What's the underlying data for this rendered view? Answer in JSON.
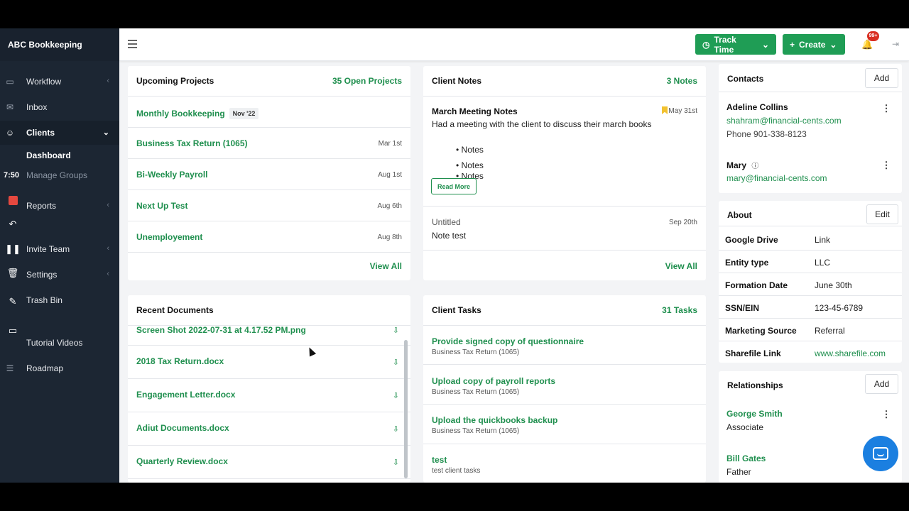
{
  "app": {
    "brand": "ABC Bookkeeping"
  },
  "sidebar": {
    "items": [
      {
        "label": "Workflow",
        "icon": "briefcase-icon"
      },
      {
        "label": "Inbox",
        "icon": "mail-icon"
      },
      {
        "label": "Clients",
        "icon": "users-icon"
      },
      {
        "label": "Reports",
        "icon": "chart-icon"
      },
      {
        "label": "Invite Team",
        "icon": "user-plus-icon"
      },
      {
        "label": "Settings",
        "icon": "gear-icon"
      },
      {
        "label": "Trash Bin",
        "icon": "trash-icon"
      },
      {
        "label": "Tutorial Videos",
        "icon": "video-icon"
      },
      {
        "label": "Roadmap",
        "icon": "roadmap-icon"
      }
    ],
    "sub_items": [
      {
        "label": "Dashboard"
      },
      {
        "label": "Manage Groups"
      }
    ],
    "recording_time": "7:50"
  },
  "topbar": {
    "track_time_label": "Track Time",
    "create_label": "Create",
    "notification_badge": "99+"
  },
  "upcoming_projects": {
    "title": "Upcoming Projects",
    "count": "35 Open Projects",
    "items": [
      {
        "name": "Monthly Bookkeeping",
        "chip": "Nov '22",
        "date": ""
      },
      {
        "name": "Business Tax Return (1065)",
        "date": "Mar 1st"
      },
      {
        "name": "Bi-Weekly Payroll",
        "date": "Aug 1st"
      },
      {
        "name": "Next Up Test",
        "date": "Aug 6th"
      },
      {
        "name": "Unemployement",
        "date": "Aug 8th"
      }
    ],
    "view_all": "View All"
  },
  "client_notes": {
    "title": "Client Notes",
    "count": "3 Notes",
    "note1": {
      "title": "March Meeting Notes",
      "date": "May 31st",
      "body": "Had a meeting with the client to discuss their march books",
      "bullets": [
        "Notes",
        "Notes",
        "Notes"
      ],
      "read_more": "Read More"
    },
    "note2": {
      "title": "Untitled",
      "date": "Sep 20th",
      "body": "Note test"
    },
    "view_all": "View All"
  },
  "recent_documents": {
    "title": "Recent Documents",
    "items": [
      {
        "name": "Screen Shot 2022-07-31 at 4.17.52 PM.png"
      },
      {
        "name": "2018 Tax Return.docx"
      },
      {
        "name": "Engagement Letter.docx"
      },
      {
        "name": "Adiut Documents.docx"
      },
      {
        "name": "Quarterly Review.docx"
      }
    ]
  },
  "client_tasks": {
    "title": "Client Tasks",
    "count": "31 Tasks",
    "items": [
      {
        "name": "Provide signed copy of questionnaire",
        "project": "Business Tax Return (1065)"
      },
      {
        "name": "Upload copy of payroll reports",
        "project": "Business Tax Return (1065)"
      },
      {
        "name": "Upload the quickbooks backup",
        "project": "Business Tax Return (1065)"
      },
      {
        "name": "test",
        "project": "test client tasks"
      }
    ]
  },
  "contacts": {
    "title": "Contacts",
    "add_label": "Add",
    "people": [
      {
        "name": "Adeline Collins",
        "email": "shahram@financial-cents.com",
        "phone": "Phone 901-338-8123"
      },
      {
        "name": "Mary",
        "email": "mary@financial-cents.com"
      }
    ]
  },
  "about": {
    "title": "About",
    "edit_label": "Edit",
    "fields": [
      {
        "key": "Google Drive",
        "value": "Link"
      },
      {
        "key": "Entity type",
        "value": "LLC"
      },
      {
        "key": "Formation Date",
        "value": "June 30th"
      },
      {
        "key": "SSN/EIN",
        "value": "123-45-6789"
      },
      {
        "key": "Marketing Source",
        "value": "Referral"
      },
      {
        "key": "Sharefile Link",
        "value": "www.sharefile.com"
      }
    ]
  },
  "relationships": {
    "title": "Relationships",
    "add_label": "Add",
    "people": [
      {
        "name": "George Smith",
        "role": "Associate"
      },
      {
        "name": "Bill Gates",
        "role": "Father"
      }
    ]
  },
  "colors": {
    "accent": "#1f9d55",
    "sidebar": "#1c2633",
    "link": "#1f8f4e",
    "bookmark": "#f2c230",
    "chat": "#1b7fe0"
  }
}
